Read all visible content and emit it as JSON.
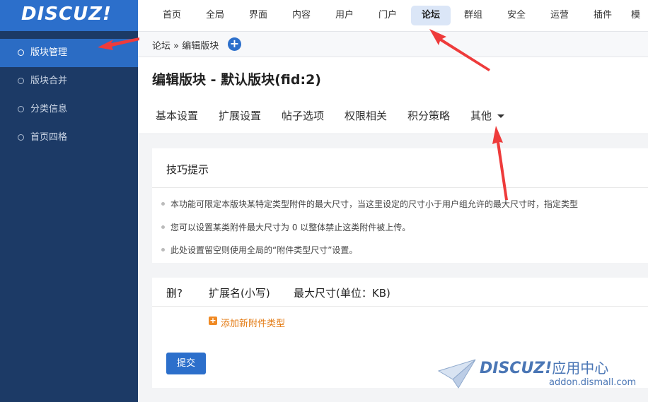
{
  "brand": {
    "logo_text": "DISCUZ!"
  },
  "sidebar": {
    "items": [
      {
        "label": "版块管理",
        "active": true
      },
      {
        "label": "版块合并"
      },
      {
        "label": "分类信息"
      },
      {
        "label": "首页四格"
      }
    ]
  },
  "topnav": {
    "items": [
      {
        "label": "首页"
      },
      {
        "label": "全局"
      },
      {
        "label": "界面"
      },
      {
        "label": "内容"
      },
      {
        "label": "用户"
      },
      {
        "label": "门户"
      },
      {
        "label": "论坛",
        "active": true
      },
      {
        "label": "群组"
      },
      {
        "label": "安全"
      },
      {
        "label": "运营"
      },
      {
        "label": "插件"
      },
      {
        "label": "模"
      }
    ]
  },
  "breadcrumb": {
    "text": "论坛 » 编辑版块",
    "plus_icon": "plus-circle-icon"
  },
  "page": {
    "title": "编辑版块 - 默认版块(fid:2)"
  },
  "tabs": [
    {
      "label": "基本设置"
    },
    {
      "label": "扩展设置"
    },
    {
      "label": "帖子选项"
    },
    {
      "label": "权限相关"
    },
    {
      "label": "积分策略"
    },
    {
      "label": "其他"
    }
  ],
  "tips": {
    "title": "技巧提示",
    "items": [
      "本功能可限定本版块某特定类型附件的最大尺寸，当这里设定的尺寸小于用户组允许的最大尺寸时，指定类型",
      "您可以设置某类附件最大尺寸为 0 以整体禁止这类附件被上传。",
      "此处设置留空则使用全局的“附件类型尺寸”设置。"
    ]
  },
  "form": {
    "columns": [
      "删?",
      "扩展名(小写)",
      "最大尺寸(单位：KB)"
    ],
    "add_link": "添加新附件类型",
    "submit": "提交"
  },
  "watermark": {
    "brand": "DISCUZ!",
    "suffix": "应用中心",
    "url": "addon.dismall.com"
  },
  "colors": {
    "accent": "#2c6fcb",
    "sidebar": "#1c3a66",
    "annotation_arrow": "#ee3b3b",
    "link": "#e37a12"
  }
}
